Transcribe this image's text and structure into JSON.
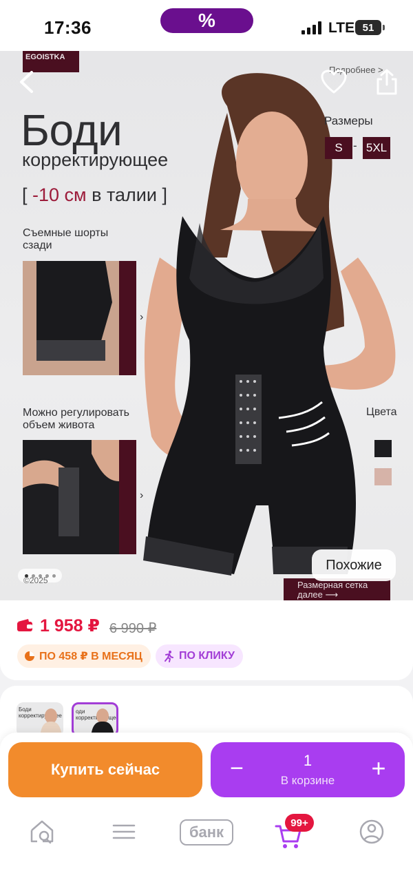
{
  "status_bar": {
    "time": "17:36",
    "pill_symbol": "%",
    "network": "LTE",
    "battery": "51"
  },
  "hero": {
    "brand": "EGOISTKA",
    "more_link": "Подробнее >",
    "title": "Боди",
    "subtitle": "корректирующее",
    "claim_open": "[ ",
    "claim_accent": "-10 см",
    "claim_rest": " в талии ]",
    "sizes_label": "Размеры",
    "size_min": "S",
    "size_dash": "-",
    "size_max": "5XL",
    "feature_1_label": "Съемные шорты сзади",
    "feature_2_label": "Можно регулировать объем живота",
    "arrow_glyph": "›",
    "colors_label": "Цвета",
    "colors": [
      "#1d1d20",
      "#d6b3a8"
    ],
    "copyright": "©2025",
    "similar_button": "Похожие",
    "size_grid_link": "Размерная сетка далее ⟶",
    "carousel_dots": 5,
    "carousel_active": 0
  },
  "price": {
    "current": "1 958 ₽",
    "old": "6 990 ₽",
    "installment_chip": "ПО 458 ₽ В МЕСЯЦ",
    "click_chip": "ПО КЛИКУ"
  },
  "thumbnails": [
    {
      "text": "Боди корректирующее",
      "selected": false
    },
    {
      "text": "оди корректирующее",
      "selected": true
    }
  ],
  "actions": {
    "buy_now": "Купить сейчас",
    "minus": "−",
    "plus": "+",
    "quantity": "1",
    "in_cart": "В корзине"
  },
  "tab_bar": {
    "bank_label": "банк",
    "cart_badge": "99+"
  },
  "colors": {
    "accent_purple": "#a93df0",
    "accent_orange": "#f28b2c",
    "price_red": "#e4163f",
    "brand_maroon": "#4a0f20"
  }
}
